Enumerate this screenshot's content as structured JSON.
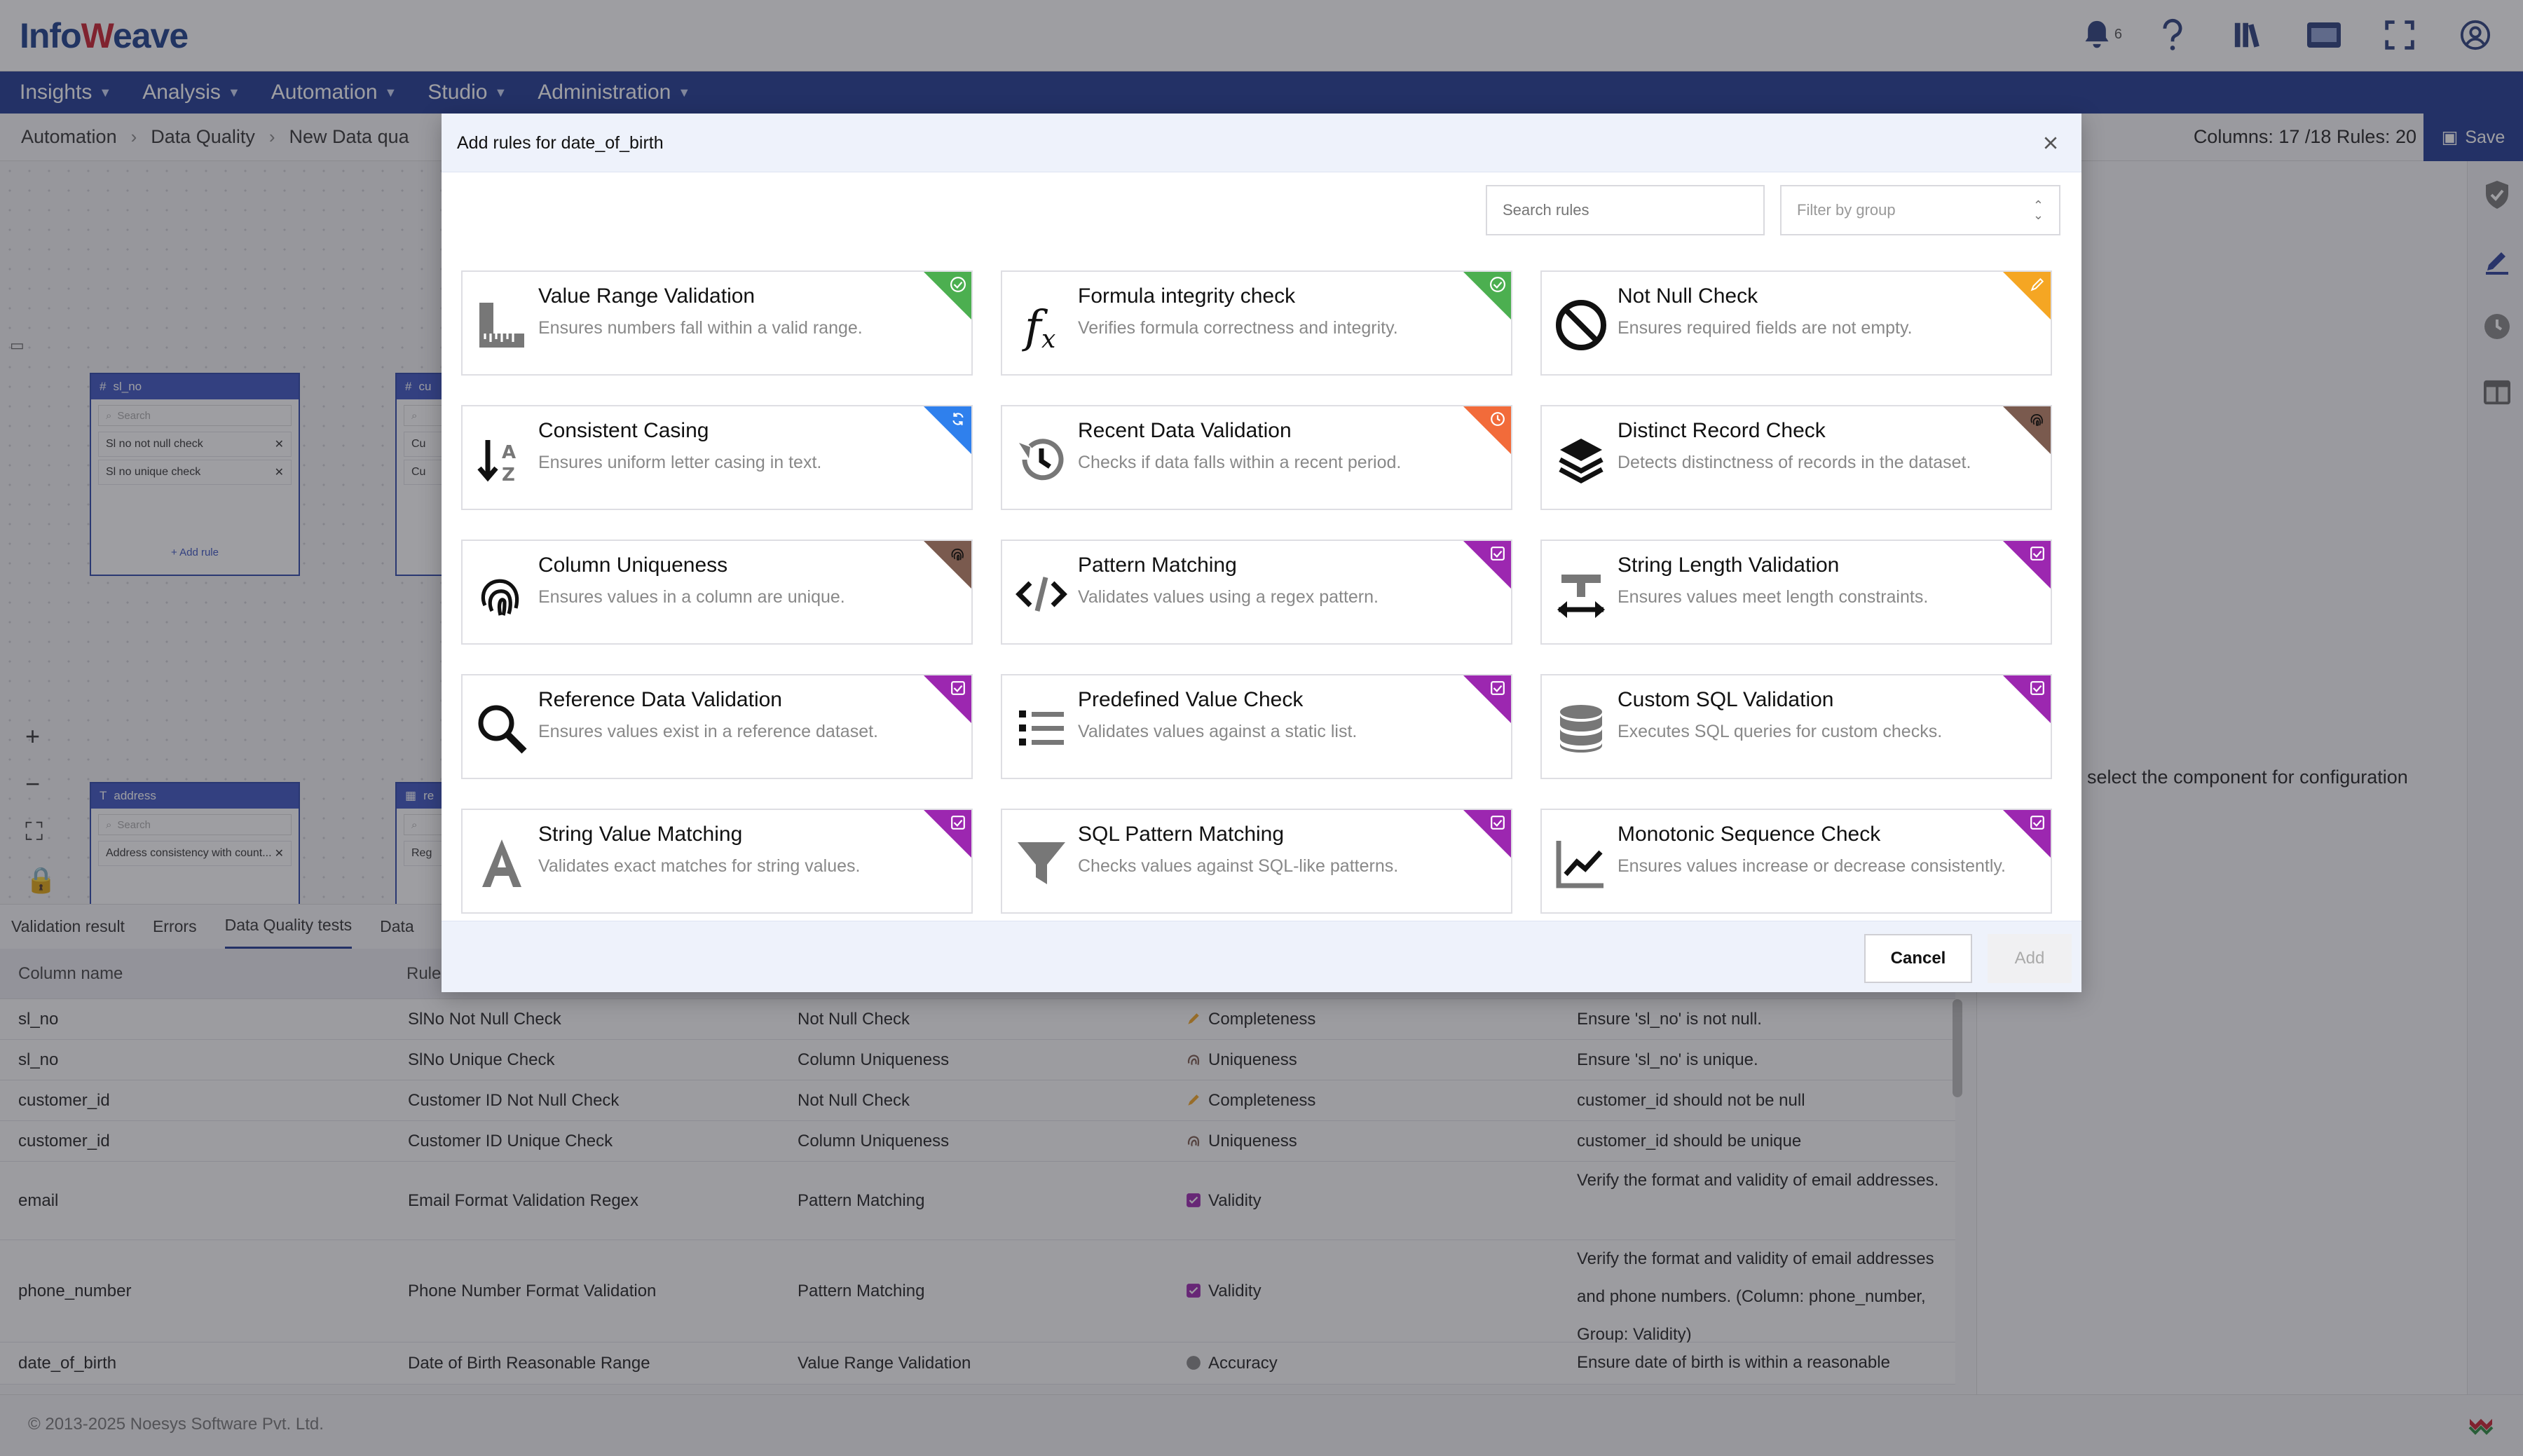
{
  "app": {
    "logo_pre": "Info",
    "logo_w": "W",
    "logo_post": "eave",
    "notifications_count": "6"
  },
  "nav": {
    "items": [
      "Insights",
      "Analysis",
      "Automation",
      "Studio",
      "Administration"
    ]
  },
  "breadcrumb": {
    "items": [
      "Automation",
      "Data Quality",
      "New Data qua"
    ],
    "stats": "Columns: 17 /18 Rules: 20",
    "save_label": "Save"
  },
  "canvas": {
    "nodes": [
      {
        "title": "sl_no",
        "search_placeholder": "Search",
        "rules": [
          "Sl no not null check",
          "Sl no unique check"
        ],
        "add_label": "+ Add rule"
      },
      {
        "title": "cu",
        "rules": [
          "Cu",
          "Cu"
        ]
      },
      {
        "title": "address",
        "search_placeholder": "Search",
        "rules": [
          "Address consistency with count..."
        ]
      },
      {
        "title": "re",
        "rules": [
          "Reg"
        ]
      }
    ]
  },
  "right_panel": {
    "hint": "select the component for configuration"
  },
  "bottom": {
    "tabs": [
      "Validation result",
      "Errors",
      "Data Quality tests",
      "Data"
    ],
    "columns": [
      "Column name",
      "Rule"
    ],
    "rows": [
      {
        "column": "sl_no",
        "rule": "SlNo Not Null Check",
        "type": "Not Null Check",
        "group": "Completeness",
        "desc": "Ensure 'sl_no' is not null."
      },
      {
        "column": "sl_no",
        "rule": "SlNo Unique Check",
        "type": "Column Uniqueness",
        "group": "Uniqueness",
        "desc": "Ensure 'sl_no' is unique."
      },
      {
        "column": "customer_id",
        "rule": "Customer ID Not Null Check",
        "type": "Not Null Check",
        "group": "Completeness",
        "desc": "customer_id should not be null"
      },
      {
        "column": "customer_id",
        "rule": "Customer ID Unique Check",
        "type": "Column Uniqueness",
        "group": "Uniqueness",
        "desc": "customer_id should be unique"
      },
      {
        "column": "email",
        "rule": "Email Format Validation Regex",
        "type": "Pattern Matching",
        "group": "Validity",
        "desc": "Verify the format and validity of email addresses."
      },
      {
        "column": "phone_number",
        "rule": "Phone Number Format Validation",
        "type": "Pattern Matching",
        "group": "Validity",
        "desc": "Verify the format and validity of email addresses and phone numbers. (Column: phone_number, Group: Validity)"
      },
      {
        "column": "date_of_birth",
        "rule": "Date of Birth Reasonable Range",
        "type": "Value Range Validation",
        "group": "Accuracy",
        "desc": "Ensure date of birth is within a reasonable"
      }
    ]
  },
  "footer": {
    "copyright": "© 2013-2025 Noesys Software Pvt. Ltd."
  },
  "modal": {
    "title": "Add rules for date_of_birth",
    "search_placeholder": "Search rules",
    "filter_placeholder": "Filter by group",
    "cancel_label": "Cancel",
    "add_label": "Add",
    "cards": [
      {
        "title": "Value Range Validation",
        "desc": "Ensures numbers fall within a valid range.",
        "icon": "ruler-icon",
        "badge_color": "#4caf50",
        "badge_icon": "check-circle-icon"
      },
      {
        "title": "Formula integrity check",
        "desc": "Verifies formula correctness and integrity.",
        "icon": "function-icon",
        "badge_color": "#4caf50",
        "badge_icon": "check-circle-icon"
      },
      {
        "title": "Not Null Check",
        "desc": "Ensures required fields are not empty.",
        "icon": "ban-icon",
        "badge_color": "#f5a623",
        "badge_icon": "pencil-icon"
      },
      {
        "title": "Consistent Casing",
        "desc": "Ensures uniform letter casing in text.",
        "icon": "sort-az-icon",
        "badge_color": "#2f80ed",
        "badge_icon": "refresh-icon"
      },
      {
        "title": "Recent Data Validation",
        "desc": "Checks if data falls within a recent period.",
        "icon": "history-icon",
        "badge_color": "#f26b3a",
        "badge_icon": "clock-icon"
      },
      {
        "title": "Distinct Record Check",
        "desc": "Detects distinctness of records in the dataset.",
        "icon": "layers-icon",
        "badge_color": "#7a5a4e",
        "badge_icon": "fingerprint-icon"
      },
      {
        "title": "Column Uniqueness",
        "desc": "Ensures values in a column are unique.",
        "icon": "fingerprint-icon",
        "badge_color": "#7a5a4e",
        "badge_icon": "fingerprint-icon"
      },
      {
        "title": "Pattern Matching",
        "desc": "Validates values using a regex pattern.",
        "icon": "code-icon",
        "badge_color": "#9c27b0",
        "badge_icon": "check-square-icon"
      },
      {
        "title": "String Length Validation",
        "desc": "Ensures values meet length constraints.",
        "icon": "text-width-icon",
        "badge_color": "#9c27b0",
        "badge_icon": "check-square-icon"
      },
      {
        "title": "Reference Data Validation",
        "desc": "Ensures values exist in a reference dataset.",
        "icon": "magnifier-icon",
        "badge_color": "#9c27b0",
        "badge_icon": "check-square-icon"
      },
      {
        "title": "Predefined Value Check",
        "desc": "Validates values against a static list.",
        "icon": "list-icon",
        "badge_color": "#9c27b0",
        "badge_icon": "check-square-icon"
      },
      {
        "title": "Custom SQL Validation",
        "desc": "Executes SQL queries for custom checks.",
        "icon": "database-icon",
        "badge_color": "#9c27b0",
        "badge_icon": "check-square-icon"
      },
      {
        "title": "String Value Matching",
        "desc": "Validates exact matches for string values.",
        "icon": "letter-a-icon",
        "badge_color": "#9c27b0",
        "badge_icon": "check-square-icon"
      },
      {
        "title": "SQL Pattern Matching",
        "desc": "Checks values against SQL-like patterns.",
        "icon": "funnel-icon",
        "badge_color": "#9c27b0",
        "badge_icon": "check-square-icon"
      },
      {
        "title": "Monotonic Sequence Check",
        "desc": "Ensures values increase or decrease consistently.",
        "icon": "trend-chart-icon",
        "badge_color": "#9c27b0",
        "badge_icon": "check-square-icon"
      }
    ]
  }
}
